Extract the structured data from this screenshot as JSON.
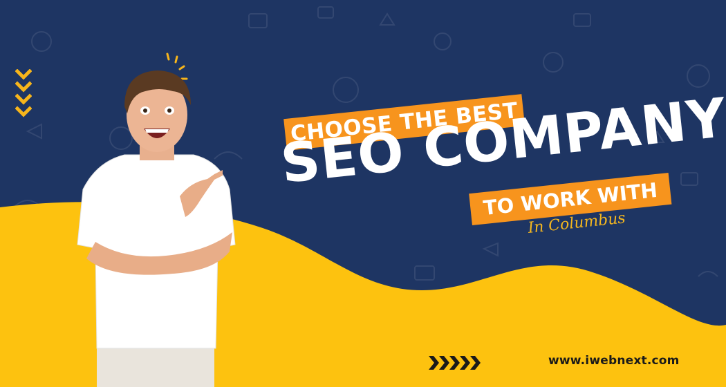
{
  "headline": {
    "line1": "CHOOSE THE BEST",
    "line2": "SEO COMPANY",
    "line3": "TO WORK WITH",
    "location": "In Columbus"
  },
  "footer": {
    "website": "www.iwebnext.com"
  },
  "icons": {
    "top_chevrons": "chevron-down-stack-icon",
    "bottom_chevrons": "chevron-right-stack-icon",
    "sparkle": "sparkle-icon"
  },
  "colors": {
    "background": "#1e3563",
    "wave": "#fdc20f",
    "accent": "#f7941d",
    "text_light": "#ffffff",
    "script_text": "#f5b71f",
    "footer_text": "#1a1a1a"
  }
}
